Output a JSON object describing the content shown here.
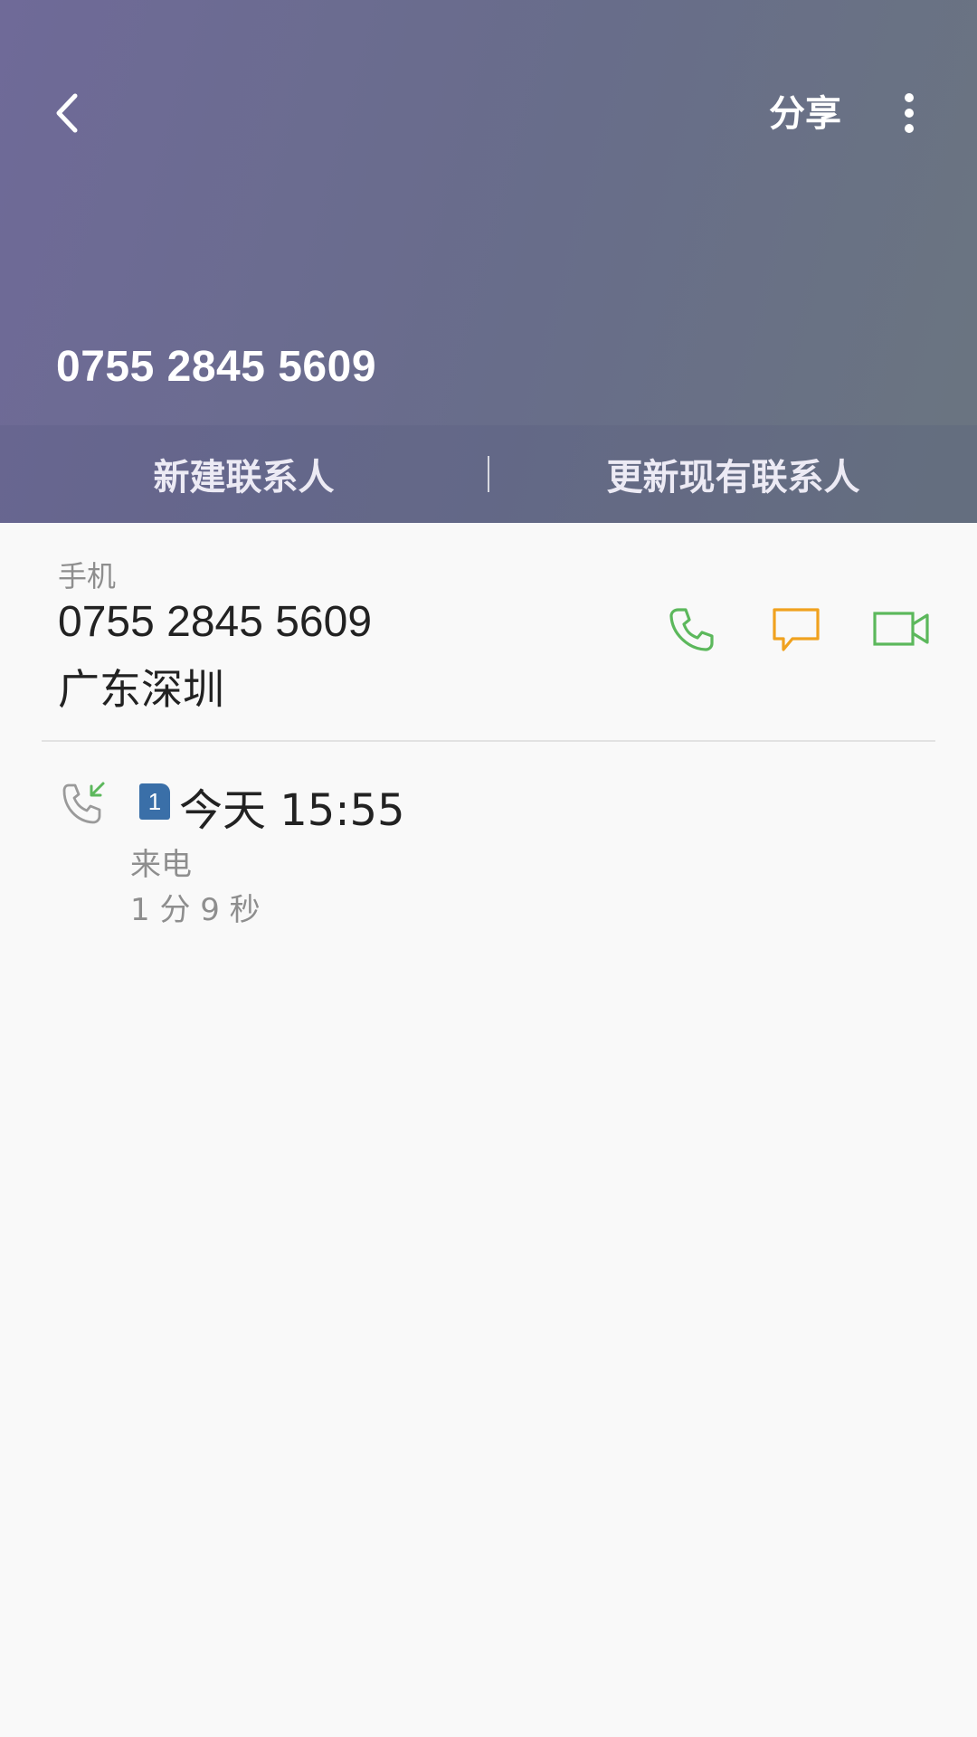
{
  "header": {
    "share_label": "分享",
    "phone_number": "0755 2845 5609",
    "new_contact_label": "新建联系人",
    "update_contact_label": "更新现有联系人"
  },
  "number_card": {
    "type_label": "手机",
    "number": "0755 2845 5609",
    "location": "广东深圳"
  },
  "call_log": {
    "sim_slot": "1",
    "time": "今天 15:55",
    "call_type": "来电",
    "duration": "1 分 9 秒"
  },
  "icons": {
    "back": "chevron-left-icon",
    "more": "more-vert-icon",
    "call": "phone-icon",
    "message": "message-icon",
    "video": "video-call-icon",
    "incoming": "incoming-call-icon"
  },
  "colors": {
    "call_green": "#5cb85c",
    "message_orange": "#f0a21f",
    "sim_blue": "#3a6fa8"
  }
}
